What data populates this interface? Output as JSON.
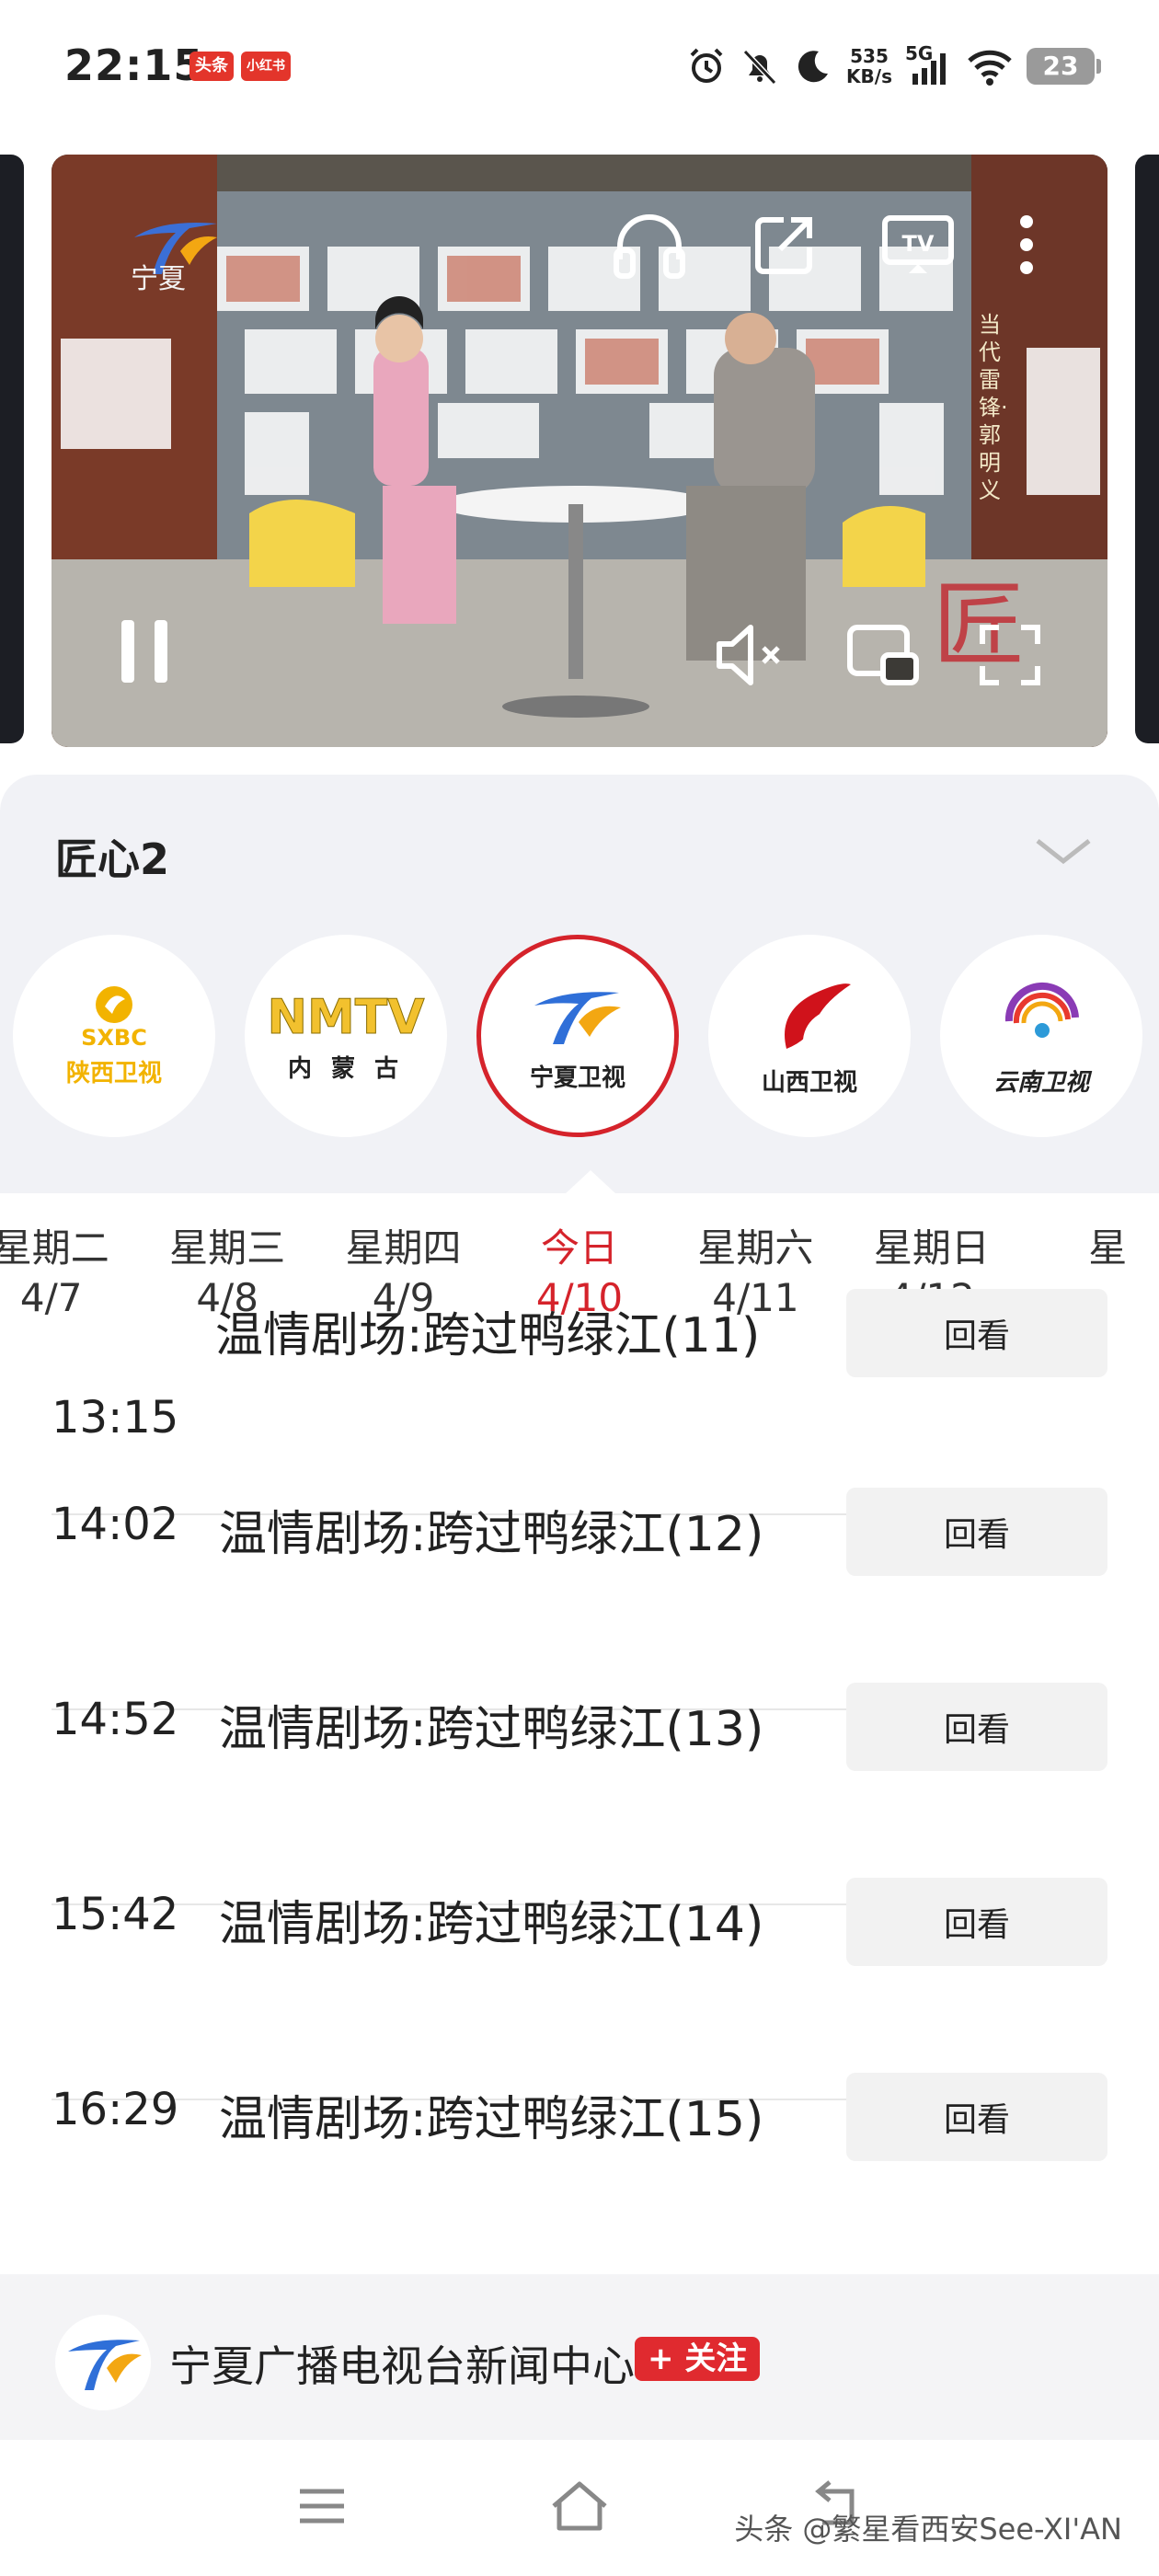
{
  "status": {
    "time": "22:15",
    "badges": [
      "头条",
      "小红书"
    ],
    "net_speed_value": "535",
    "net_speed_unit": "KB/s",
    "signal_label": "5G",
    "battery": "23"
  },
  "player": {
    "channel_logo_text": "宁夏",
    "caption": "当代雷锋·郭明义",
    "watermark": "匠",
    "icons": [
      "headphones-icon",
      "share-icon",
      "tv-cast-icon",
      "more-icon",
      "pause-icon",
      "mute-icon",
      "picture-in-picture-icon",
      "fullscreen-icon"
    ]
  },
  "program": {
    "title": "匠心2"
  },
  "channels": [
    {
      "name": "陕西卫视",
      "logo_text": "SXBC"
    },
    {
      "name": "内 蒙 古",
      "logo_text": "NMTV"
    },
    {
      "name": "宁夏卫视",
      "logo_text": ""
    },
    {
      "name": "山西卫视",
      "logo_text": ""
    },
    {
      "name": "云南卫视",
      "logo_text": ""
    }
  ],
  "dates": [
    {
      "day": "星期二",
      "date": "4/7"
    },
    {
      "day": "星期三",
      "date": "4/8"
    },
    {
      "day": "星期四",
      "date": "4/9"
    },
    {
      "day": "今日",
      "date": "4/10"
    },
    {
      "day": "星期六",
      "date": "4/11"
    },
    {
      "day": "星期日",
      "date": "4/12"
    },
    {
      "day": "星",
      "date": ""
    }
  ],
  "schedule": [
    {
      "time": "13:15",
      "title": "温情剧场:跨过鸭绿江(11)",
      "action": "回看"
    },
    {
      "time": "14:02",
      "title": "温情剧场:跨过鸭绿江(12)",
      "action": "回看"
    },
    {
      "time": "14:52",
      "title": "温情剧场:跨过鸭绿江(13)",
      "action": "回看"
    },
    {
      "time": "15:42",
      "title": "温情剧场:跨过鸭绿江(14)",
      "action": "回看"
    },
    {
      "time": "16:29",
      "title": "温情剧场:跨过鸭绿江(15)",
      "action": "回看"
    }
  ],
  "footer": {
    "account_name": "宁夏广播电视台新闻中心",
    "follow_label": "+ 关注"
  },
  "nav": {
    "watermark": "头条 @繁星看西安See-XI'AN"
  },
  "colors": {
    "accent": "#d5232b",
    "panel_bg": "#f1f2f6",
    "button_bg": "#f2f2f2"
  }
}
